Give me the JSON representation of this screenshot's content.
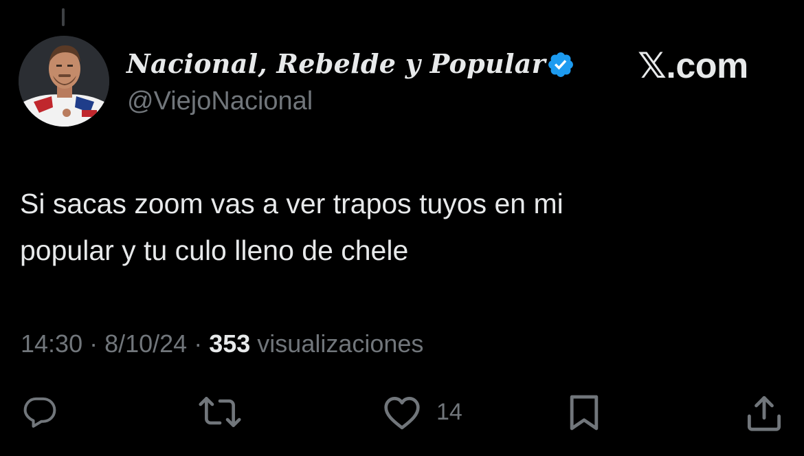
{
  "author": {
    "display_name": "Nacional, Rebelde y Popular",
    "handle": "@ViejoNacional",
    "verified": true,
    "verified_icon": "verified-badge-icon",
    "verified_color": "#1d9bf0"
  },
  "site": {
    "logo_text": "𝕏.com"
  },
  "tweet": {
    "text_line_1": "Si sacas zoom vas a ver trapos tuyos en mi",
    "text_line_2": "popular y tu culo lleno de chele"
  },
  "meta": {
    "time": "14:30",
    "separator": " · ",
    "date": "8/10/24",
    "views_count": "353",
    "views_label": " visualizaciones"
  },
  "actions": {
    "reply_icon": "reply-icon",
    "retweet_icon": "retweet-icon",
    "like_icon": "heart-icon",
    "like_count": "14",
    "bookmark_icon": "bookmark-icon",
    "share_icon": "share-icon"
  },
  "colors": {
    "background": "#000000",
    "primary_text": "#e7e9ea",
    "secondary_text": "#71767b",
    "accent": "#1d9bf0"
  }
}
